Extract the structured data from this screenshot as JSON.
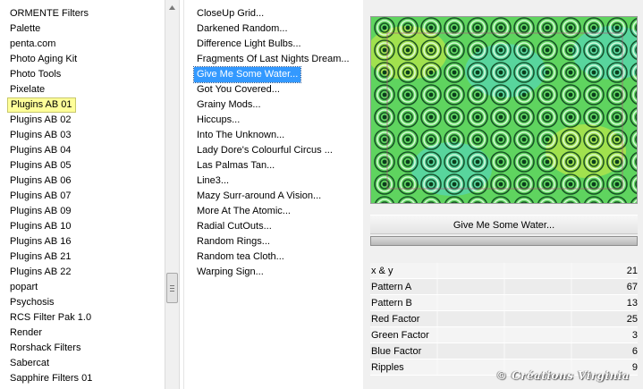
{
  "categories": [
    {
      "label": "ORMENTE Filters"
    },
    {
      "label": "Palette"
    },
    {
      "label": "penta.com"
    },
    {
      "label": "Photo Aging Kit"
    },
    {
      "label": "Photo Tools"
    },
    {
      "label": "Pixelate"
    },
    {
      "label": "Plugins AB 01",
      "selected": true
    },
    {
      "label": "Plugins AB 02"
    },
    {
      "label": "Plugins AB 03"
    },
    {
      "label": "Plugins AB 04"
    },
    {
      "label": "Plugins AB 05"
    },
    {
      "label": "Plugins AB 06"
    },
    {
      "label": "Plugins AB 07"
    },
    {
      "label": "Plugins AB 09"
    },
    {
      "label": "Plugins AB 10"
    },
    {
      "label": "Plugins AB 16"
    },
    {
      "label": "Plugins AB 21"
    },
    {
      "label": "Plugins AB 22"
    },
    {
      "label": "popart"
    },
    {
      "label": "Psychosis"
    },
    {
      "label": "RCS Filter Pak 1.0"
    },
    {
      "label": "Render"
    },
    {
      "label": "Rorshack Filters"
    },
    {
      "label": "Sabercat"
    },
    {
      "label": "Sapphire Filters 01"
    }
  ],
  "filters": [
    {
      "label": "CloseUp Grid..."
    },
    {
      "label": "Darkened Random..."
    },
    {
      "label": "Difference Light Bulbs..."
    },
    {
      "label": "Fragments Of Last Nights Dream..."
    },
    {
      "label": "Give Me Some Water...",
      "selected": true
    },
    {
      "label": "Got You Covered..."
    },
    {
      "label": "Grainy Mods..."
    },
    {
      "label": "Hiccups..."
    },
    {
      "label": "Into The Unknown..."
    },
    {
      "label": "Lady Dore's Colourful Circus ..."
    },
    {
      "label": "Las Palmas Tan..."
    },
    {
      "label": "Line3..."
    },
    {
      "label": "Mazy Surr-around A Vision..."
    },
    {
      "label": "More At The Atomic..."
    },
    {
      "label": "Radial CutOuts..."
    },
    {
      "label": "Random Rings..."
    },
    {
      "label": "Random tea Cloth..."
    },
    {
      "label": "Warping Sign..."
    }
  ],
  "preview": {
    "filter_name": "Give Me Some Water...",
    "colors": {
      "base": "#5fd45f",
      "ring_dark": "#0b3d1c",
      "ring_light": "#e8ffe8",
      "accent_yellow": "#f2f23a",
      "accent_cyan": "#4fd8e8"
    }
  },
  "params": [
    {
      "label": "x & y",
      "value": "21"
    },
    {
      "label": "Pattern A",
      "value": "67"
    },
    {
      "label": "Pattern B",
      "value": "13"
    },
    {
      "label": "Red Factor",
      "value": "25"
    },
    {
      "label": "Green Factor",
      "value": "3"
    },
    {
      "label": "Blue Factor",
      "value": "6"
    },
    {
      "label": "Ripples",
      "value": "9"
    }
  ],
  "watermark": "© Créations Virginia",
  "icons": {
    "scroll_up": "triangle-up-icon",
    "scroll_grip": "grip-lines-icon"
  }
}
